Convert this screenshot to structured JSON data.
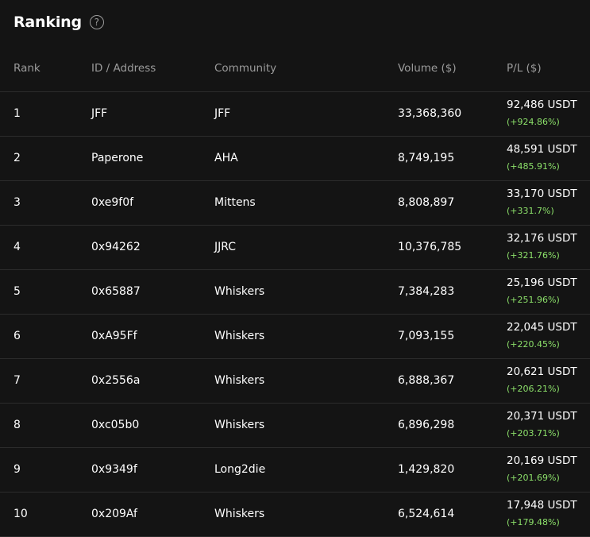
{
  "header": {
    "title": "Ranking",
    "help_icon": "?"
  },
  "colors": {
    "background": "#141414",
    "positive": "#8ce06a",
    "muted_text": "#9b9b9b"
  },
  "columns": {
    "rank": "Rank",
    "id": "ID / Address",
    "community": "Community",
    "volume": "Volume ($)",
    "pl": "P/L ($)"
  },
  "rows": [
    {
      "rank": "1",
      "id": "JFF",
      "community": "JFF",
      "volume": "33,368,360",
      "pl_amount": "92,486 USDT",
      "pl_pct": "(+924.86%)"
    },
    {
      "rank": "2",
      "id": "Paperone",
      "community": "AHA",
      "volume": "8,749,195",
      "pl_amount": "48,591 USDT",
      "pl_pct": "(+485.91%)"
    },
    {
      "rank": "3",
      "id": "0xe9f0f",
      "community": "Mittens",
      "volume": "8,808,897",
      "pl_amount": "33,170 USDT",
      "pl_pct": "(+331.7%)"
    },
    {
      "rank": "4",
      "id": "0x94262",
      "community": "JJRC",
      "volume": "10,376,785",
      "pl_amount": "32,176 USDT",
      "pl_pct": "(+321.76%)"
    },
    {
      "rank": "5",
      "id": "0x65887",
      "community": "Whiskers",
      "volume": "7,384,283",
      "pl_amount": "25,196 USDT",
      "pl_pct": "(+251.96%)"
    },
    {
      "rank": "6",
      "id": "0xA95Ff",
      "community": "Whiskers",
      "volume": "7,093,155",
      "pl_amount": "22,045 USDT",
      "pl_pct": "(+220.45%)"
    },
    {
      "rank": "7",
      "id": "0x2556a",
      "community": "Whiskers",
      "volume": "6,888,367",
      "pl_amount": "20,621 USDT",
      "pl_pct": "(+206.21%)"
    },
    {
      "rank": "8",
      "id": "0xc05b0",
      "community": "Whiskers",
      "volume": "6,896,298",
      "pl_amount": "20,371 USDT",
      "pl_pct": "(+203.71%)"
    },
    {
      "rank": "9",
      "id": "0x9349f",
      "community": "Long2die",
      "volume": "1,429,820",
      "pl_amount": "20,169 USDT",
      "pl_pct": "(+201.69%)"
    },
    {
      "rank": "10",
      "id": "0x209Af",
      "community": "Whiskers",
      "volume": "6,524,614",
      "pl_amount": "17,948 USDT",
      "pl_pct": "(+179.48%)"
    }
  ]
}
